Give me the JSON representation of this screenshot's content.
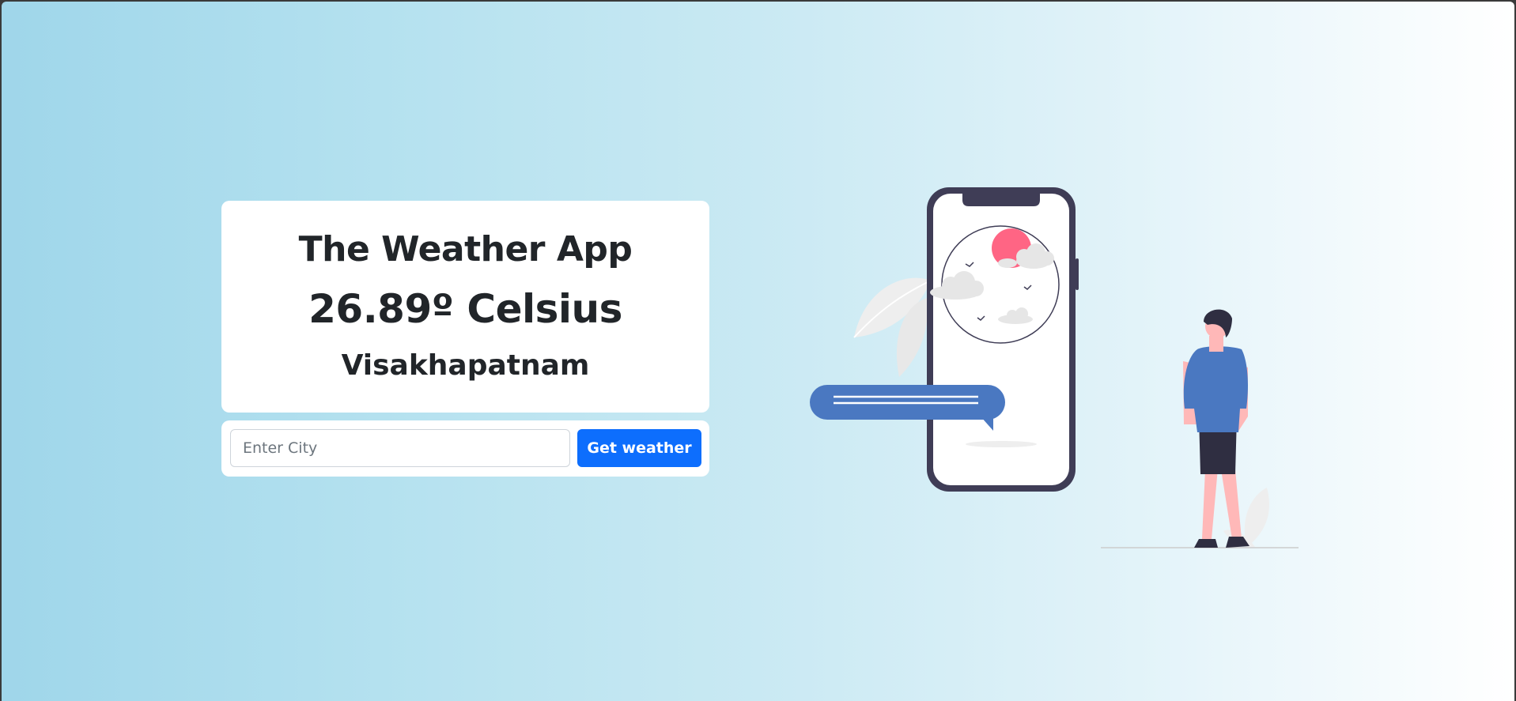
{
  "app": {
    "title": "The Weather App",
    "temperature": "26.89º Celsius",
    "city": "Visakhapatnam"
  },
  "search": {
    "placeholder": "Enter City",
    "value": "",
    "button_label": "Get weather"
  },
  "colors": {
    "button": "#0d6efd",
    "sun": "#ff6584",
    "shirt": "#4a78c1",
    "chat_bubble": "#4a78c1"
  }
}
